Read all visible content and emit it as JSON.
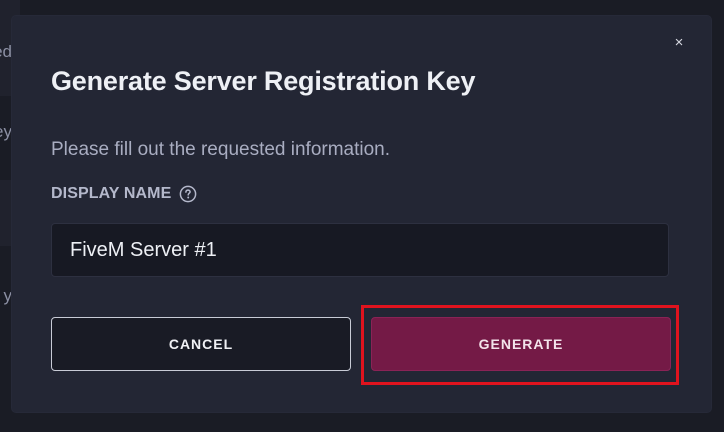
{
  "background": {
    "fragments": [
      "ed",
      "ey",
      "y"
    ]
  },
  "modal": {
    "title": "Generate Server Registration Key",
    "subtitle": "Please fill out the requested information.",
    "close_icon": "close-icon",
    "close_label": "×",
    "field": {
      "label": "DISPLAY NAME",
      "help_icon": "help-circle-icon",
      "value": "FiveM Server #1",
      "placeholder": ""
    },
    "buttons": {
      "cancel_label": "CANCEL",
      "generate_label": "GENERATE"
    }
  },
  "colors": {
    "modal_bg": "#232634",
    "page_bg": "#191b24",
    "accent": "#741a46",
    "highlight": "#e0131e"
  }
}
